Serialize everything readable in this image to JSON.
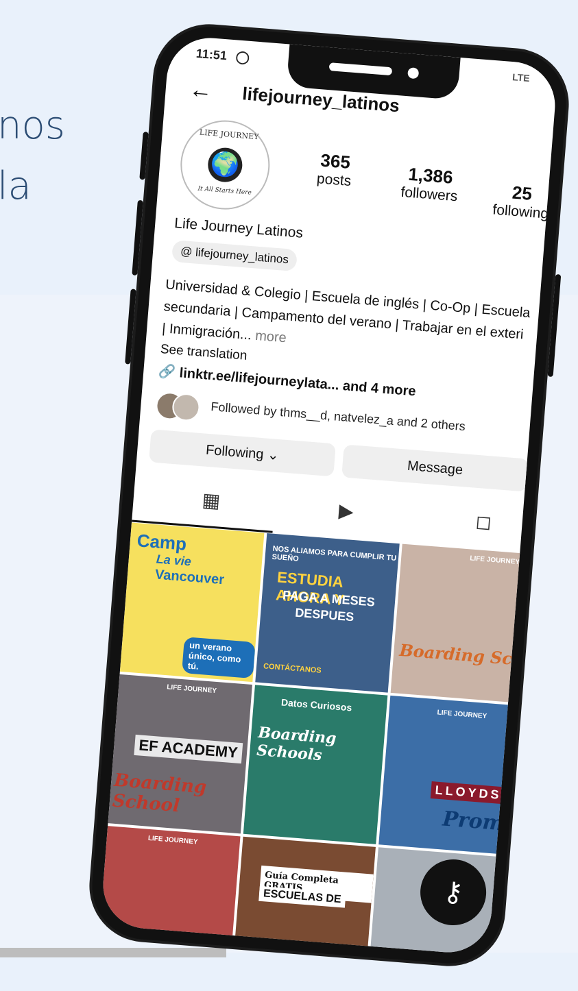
{
  "background": {
    "line1": "nos",
    "line2": "la"
  },
  "status_bar": {
    "time": "11:51",
    "whatsapp_icon": "whatsapp-icon",
    "signal": "LTE"
  },
  "header": {
    "back_icon": "arrow-left-icon",
    "username": "lifejourney_latinos"
  },
  "avatar": {
    "ring_top": "LIFE JOURNEY",
    "ring_bottom": "It All Starts Here"
  },
  "stats": {
    "posts_count": "365",
    "posts_label": "posts",
    "followers_count": "1,386",
    "followers_label": "followers",
    "following_count": "25",
    "following_label": "following"
  },
  "profile": {
    "display_name": "Life Journey Latinos",
    "threads_handle": "lifejourney_latinos",
    "bio_line1": "Universidad & Colegio | Escuela de inglés | Co-Op | Escuela",
    "bio_line2": "secundaria | Campamento del verano | Trabajar en el exteri",
    "bio_line3": "| Inmigración...",
    "bio_more": "more",
    "see_translation": "See translation",
    "link": "linktr.ee/lifejourneylata... and 4 more",
    "followed_by": "Followed by thms__d, natvelez_a and 2 others"
  },
  "actions": {
    "following": "Following ⌄",
    "message": "Message",
    "add": "+"
  },
  "tabs": {
    "grid_icon": "grid-icon",
    "reels_icon": "reels-icon",
    "tagged_icon": "tagged-user-icon"
  },
  "posts": {
    "p1_a": "Camp",
    "p1_b": "La vie",
    "p1_c": "Vancouver",
    "p1_d": "un verano único, como tú.",
    "p2_a": "NOS ALIAMOS PARA CUMPLIR TU SUEÑO",
    "p2_b": "ESTUDIA AHORA Y",
    "p2_c": "PAGA A MESES",
    "p2_d": "DESPUES",
    "p2_e": "CONTÁCTANOS",
    "p3_a": "LIFE JOURNEY",
    "p3_b": "Boarding Sch",
    "p4_a": "LIFE JOURNEY",
    "p4_b": "EF ACADEMY",
    "p4_c": "Boarding School",
    "p5_a": "Datos Curiosos",
    "p5_b": "Boarding Schools",
    "p6_a": "LIFE JOURNEY",
    "p6_b": "LLOYDS",
    "p6_c": "Promo",
    "p7_a": "LIFE JOURNEY",
    "p8_a": "Guía Completa GRATIS",
    "p8_b": "ESCUELAS DE"
  },
  "fab_icon": "key-icon",
  "colors": {
    "background": "#e9f1fb",
    "accent_text": "#2c4d74"
  }
}
